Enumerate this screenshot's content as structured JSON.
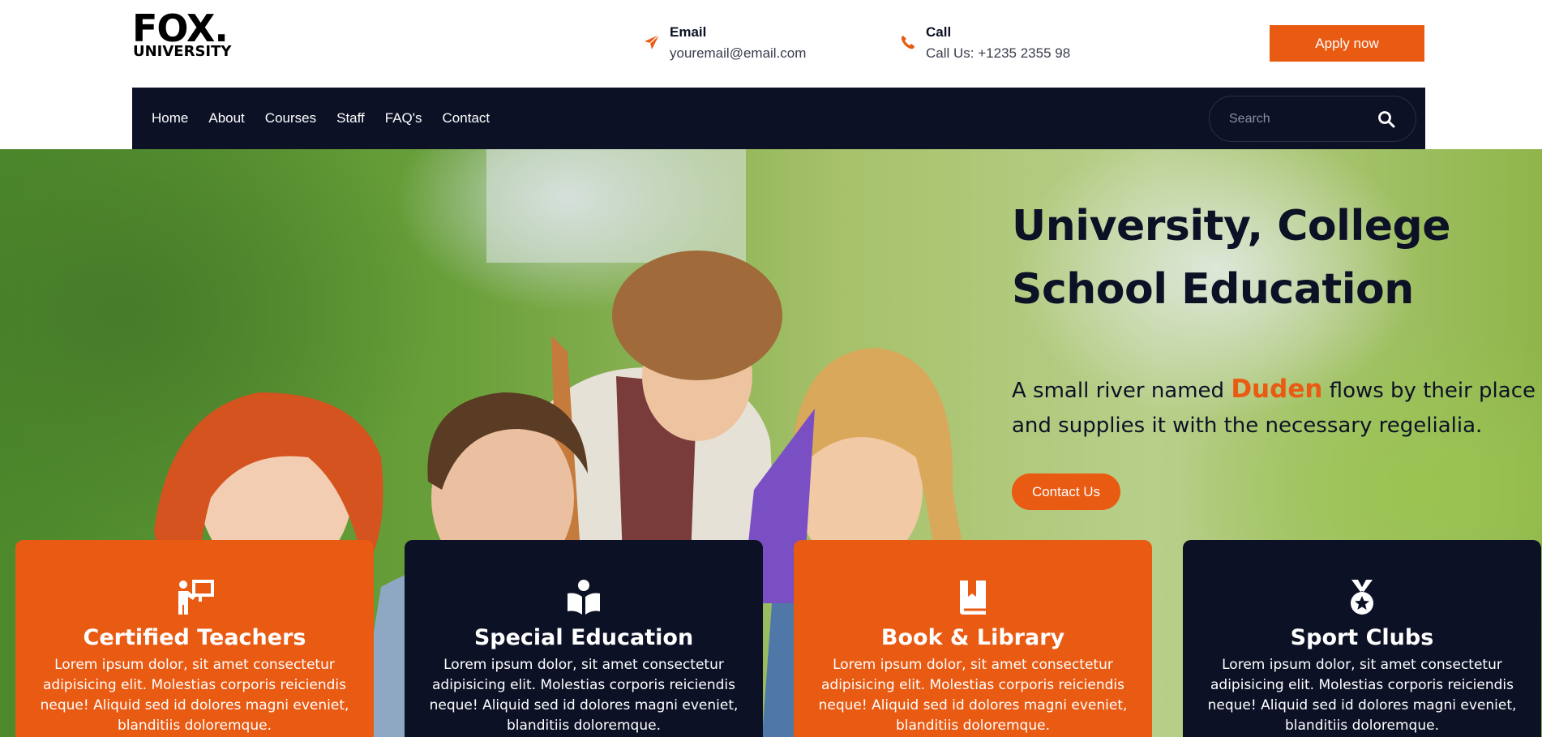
{
  "logo": {
    "main": "FOX.",
    "sub": "UNIVERSITY"
  },
  "contacts": {
    "email": {
      "title": "Email",
      "value": "youremail@email.com",
      "icon": "paper-plane-icon"
    },
    "call": {
      "title": "Call",
      "value": "Call Us: +1235 2355 98",
      "icon": "phone-icon"
    }
  },
  "header": {
    "apply_label": "Apply now"
  },
  "nav": {
    "items": [
      "Home",
      "About",
      "Courses",
      "Staff",
      "FAQ's",
      "Contact"
    ],
    "search_placeholder": "Search"
  },
  "hero": {
    "title": "University, College School Education",
    "text_before": "A small river named ",
    "text_accent": "Duden",
    "text_after": " flows by their place and supplies it with the necessary regelialia.",
    "button_label": "Contact Us"
  },
  "cards": [
    {
      "title": "Certified Teachers",
      "text": "Lorem ipsum dolor, sit amet consectetur adipisicing elit. Molestias corporis reiciendis neque! Aliquid sed id dolores magni eveniet, blanditiis doloremque.",
      "icon": "teacher-icon",
      "color": "#e95a12"
    },
    {
      "title": "Special Education",
      "text": "Lorem ipsum dolor, sit amet consectetur adipisicing elit. Molestias corporis reiciendis neque! Aliquid sed id dolores magni eveniet, blanditiis doloremque.",
      "icon": "open-book-reader-icon",
      "color": "#0c1126"
    },
    {
      "title": "Book & Library",
      "text": "Lorem ipsum dolor, sit amet consectetur adipisicing elit. Molestias corporis reiciendis neque! Aliquid sed id dolores magni eveniet, blanditiis doloremque.",
      "icon": "book-icon",
      "color": "#e95a12"
    },
    {
      "title": "Sport Clubs",
      "text": "Lorem ipsum dolor, sit amet consectetur adipisicing elit. Molestias corporis reiciendis neque! Aliquid sed id dolores magni eveniet, blanditiis doloremque.",
      "icon": "medal-icon",
      "color": "#0c1126"
    }
  ],
  "colors": {
    "accent": "#e95a12",
    "navy": "#0c1126"
  }
}
